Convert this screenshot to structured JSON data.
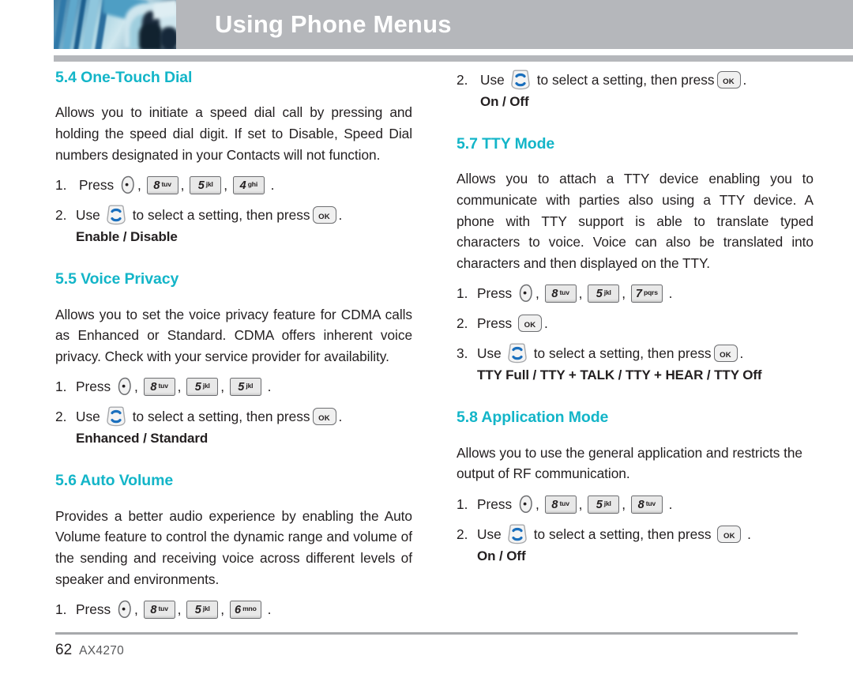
{
  "header": {
    "title": "Using Phone Menus",
    "banner_photo_alt": "blue abstract photo"
  },
  "footer": {
    "page_number": "62",
    "model": "AX4270"
  },
  "icons": {
    "menu_key": "menu-key-icon",
    "nav_key": "navigation-up-down-key-icon",
    "ok_key": "ok-key-icon",
    "ok_label": "OK"
  },
  "keys": {
    "k8": {
      "digit": "8",
      "letters": "tuv"
    },
    "k5": {
      "digit": "5",
      "letters": "jkl"
    },
    "k4": {
      "digit": "4",
      "letters": "ghi"
    },
    "k6": {
      "digit": "6",
      "letters": "mno"
    },
    "k7": {
      "digit": "7",
      "letters": "pqrs"
    }
  },
  "phrases": {
    "press": "Press",
    "use": "Use",
    "to_select": "to select a setting, then press",
    "period": ".",
    "comma": ","
  },
  "left_column": {
    "sections": [
      {
        "id": "one-touch-dial",
        "number_title": "5.4 One-Touch Dial",
        "body": "Allows you to initiate a speed dial call by pressing and holding the speed dial digit. If set to Disable, Speed Dial numbers designated in your Contacts will not function.",
        "step1_num": "1.",
        "step1_label": "Press",
        "step2_num": "2.",
        "step2_label": "Use",
        "step2_tail": "to select a setting, then press",
        "options": "Enable / Disable"
      },
      {
        "id": "voice-privacy",
        "number_title": "5.5 Voice Privacy",
        "body": "Allows you to set the voice privacy feature for CDMA calls as Enhanced or Standard. CDMA offers inherent voice privacy. Check with your service provider for availability.",
        "step1_num": "1.",
        "step1_label": "Press",
        "step2_num": "2.",
        "step2_label": "Use",
        "step2_tail": "to select a setting, then press",
        "options": "Enhanced / Standard"
      },
      {
        "id": "auto-volume",
        "number_title": "5.6 Auto Volume",
        "body": "Provides a better audio experience by enabling the Auto Volume feature to control the dynamic range and volume of the sending and receiving voice across different levels of speaker and environments.",
        "step1_num": "1.",
        "step1_label": "Press"
      }
    ]
  },
  "right_column": {
    "continued_step": {
      "num": "2.",
      "label": "Use",
      "tail": "to select a setting, then press",
      "options": "On / Off"
    },
    "sections": [
      {
        "id": "tty-mode",
        "number_title": "5.7 TTY Mode",
        "body": "Allows you to attach a TTY device enabling you to communicate with parties also using a TTY device. A phone with TTY support is able to translate typed characters to voice. Voice can also be translated into characters and then displayed on the TTY.",
        "step1_num": "1.",
        "step1_label": "Press",
        "step2_num": "2.",
        "step2_label": "Press",
        "step3_num": "3.",
        "step3_label": "Use",
        "step3_tail": "to select a setting, then press",
        "options": "TTY Full / TTY + TALK / TTY + HEAR / TTY Off"
      },
      {
        "id": "application-mode",
        "number_title": "5.8 Application Mode",
        "body": "Allows you to use the general application and restricts the output of RF communication.",
        "step1_num": "1.",
        "step1_label": "Press",
        "step2_num": "2.",
        "step2_label": "Use",
        "step2_tail": "to select a setting, then press",
        "options": "On / Off"
      }
    ]
  }
}
